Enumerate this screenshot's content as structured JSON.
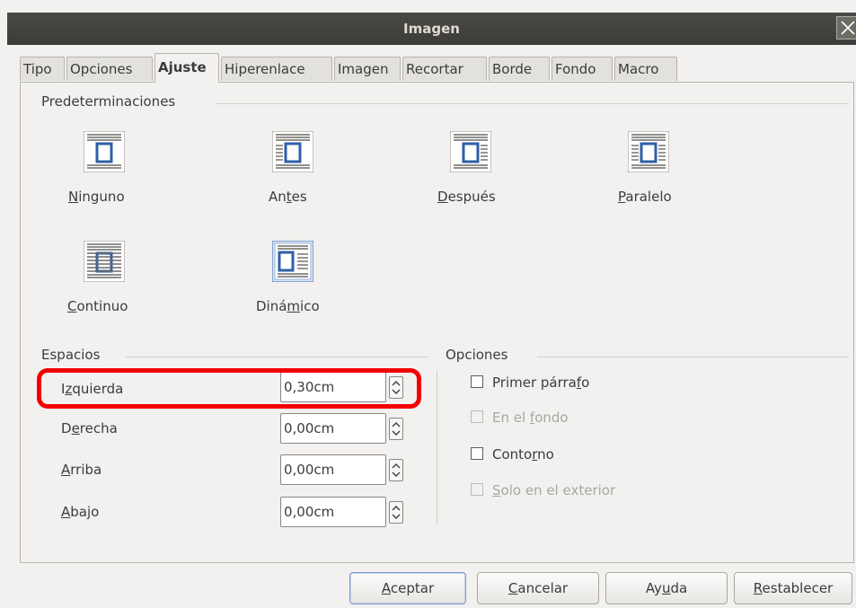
{
  "window": {
    "title": "Imagen"
  },
  "tabs": [
    {
      "label": "Tipo"
    },
    {
      "label": "Opciones"
    },
    {
      "label": "Ajuste"
    },
    {
      "label": "Hiperenlace"
    },
    {
      "label": "Imagen"
    },
    {
      "label": "Recortar"
    },
    {
      "label": "Borde"
    },
    {
      "label": "Fondo"
    },
    {
      "label": "Macro"
    }
  ],
  "active_tab": "Ajuste",
  "presets": {
    "label": "Predeterminaciones",
    "items": [
      {
        "pre": "",
        "key": "N",
        "post": "inguno",
        "selected": false
      },
      {
        "pre": "An",
        "key": "t",
        "post": "es",
        "selected": false
      },
      {
        "pre": "",
        "key": "D",
        "post": "espués",
        "selected": false
      },
      {
        "pre": "",
        "key": "P",
        "post": "aralelo",
        "selected": false
      },
      {
        "pre": "",
        "key": "C",
        "post": "ontinuo",
        "selected": false
      },
      {
        "pre": "Diná",
        "key": "m",
        "post": "ico",
        "selected": true
      }
    ]
  },
  "spacing": {
    "label": "Espacios",
    "rows": [
      {
        "pre": "I",
        "key": "z",
        "post": "quierda",
        "value": "0,30cm"
      },
      {
        "pre": "D",
        "key": "e",
        "post": "recha",
        "value": "0,00cm"
      },
      {
        "pre": "",
        "key": "A",
        "post": "rriba",
        "value": "0,00cm"
      },
      {
        "pre": "",
        "key": "A",
        "post": "bajo",
        "value": "0,00cm"
      }
    ]
  },
  "options": {
    "label": "Opciones",
    "items": [
      {
        "pre": "Primer párra",
        "key": "f",
        "post": "o",
        "checked": false,
        "enabled": true
      },
      {
        "pre": "En el ",
        "key": "f",
        "post": "ondo",
        "checked": false,
        "enabled": false
      },
      {
        "pre": "Conto",
        "key": "r",
        "post": "no",
        "checked": false,
        "enabled": true
      },
      {
        "pre": "",
        "key": "S",
        "post": "olo en el exterior",
        "checked": false,
        "enabled": false
      }
    ]
  },
  "buttons": [
    {
      "pre": "",
      "key": "A",
      "post": "ceptar"
    },
    {
      "pre": "",
      "key": "C",
      "post": "ancelar"
    },
    {
      "pre": "Ay",
      "key": "u",
      "post": "da"
    },
    {
      "pre": "",
      "key": "R",
      "post": "establecer"
    }
  ],
  "colors": {
    "highlight": "#f30000",
    "accent": "#2f5fa8"
  }
}
